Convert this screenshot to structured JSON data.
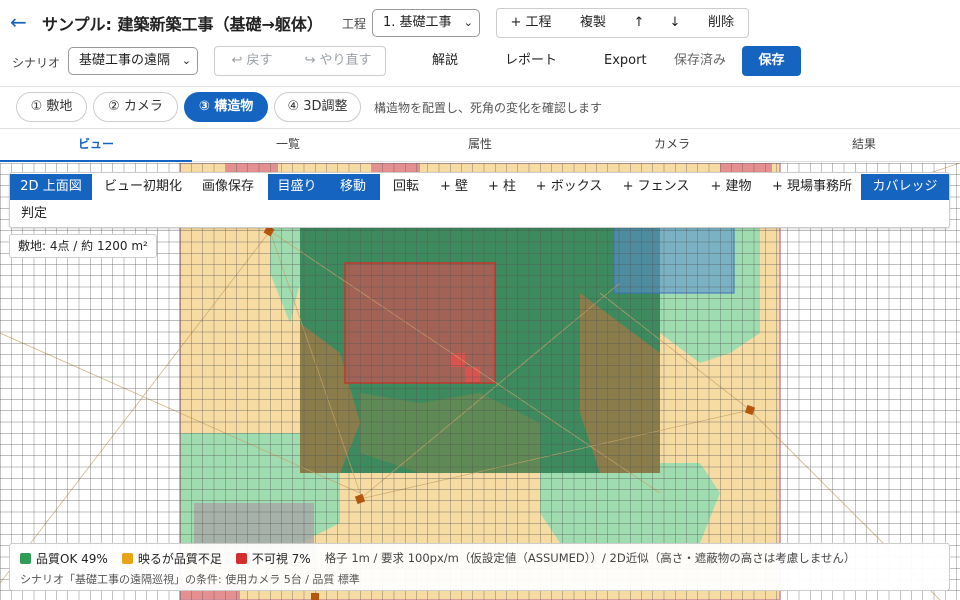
{
  "header": {
    "back_icon": "←",
    "title": "サンプル: 建築新築工事（基礎→躯体）",
    "phase_label": "工程",
    "phase_value": "1. 基礎工事",
    "actions": {
      "add_phase": "+ 工程",
      "duplicate": "複製",
      "move_up": "↑",
      "move_down": "↓",
      "delete": "削除"
    },
    "scenario_label": "シナリオ",
    "scenario_value": "基礎工事の遠隔",
    "undo": "↩ 戻す",
    "redo": "↪ やり直す",
    "explain": "解説",
    "report": "レポート",
    "export": "Export",
    "saved_status": "保存済み",
    "save": "保存"
  },
  "steps": {
    "items": [
      {
        "label": "① 敷地",
        "active": false
      },
      {
        "label": "② カメラ",
        "active": false
      },
      {
        "label": "③ 構造物",
        "active": true
      },
      {
        "label": "④ 3D調整",
        "active": false
      }
    ],
    "hint": "構造物を配置し、死角の変化を確認します"
  },
  "tabs": [
    {
      "label": "ビュー",
      "active": true
    },
    {
      "label": "一覧",
      "active": false
    },
    {
      "label": "属性",
      "active": false
    },
    {
      "label": "カメラ",
      "active": false
    },
    {
      "label": "結果",
      "active": false
    }
  ],
  "toolbar": {
    "view_2d": "2D 上面図",
    "reset_view": "ビュー初期化",
    "save_image": "画像保存",
    "scale": "目盛り",
    "move": "移動",
    "rotate": "回転",
    "add_wall": "+ 壁",
    "add_column": "+ 柱",
    "add_box": "+ ボックス",
    "add_fence": "+ フェンス",
    "add_building": "+ 建物",
    "add_site_office": "+ 現場事務所",
    "coverage": "カバレッジ",
    "judge": "判定"
  },
  "site_info": "敷地: 4点 / 約 1200 m²",
  "legend": {
    "ok": "品質OK 49%",
    "low": "映るが品質不足",
    "invisible": "不可視 7%",
    "note": "格子 1m / 要求 100px/m（仮設定値（ASSUMED））/ 2D近似（高さ・遮蔽物の高さは考慮しません）",
    "condition": "シナリオ「基礎工事の遠隔巡視」の条件: 使用カメラ 5台 / 品質 標準"
  },
  "colors": {
    "accent": "#1565c0",
    "ok": "#2e9e57",
    "low": "#e8a317",
    "invisible": "#d32f2f"
  }
}
